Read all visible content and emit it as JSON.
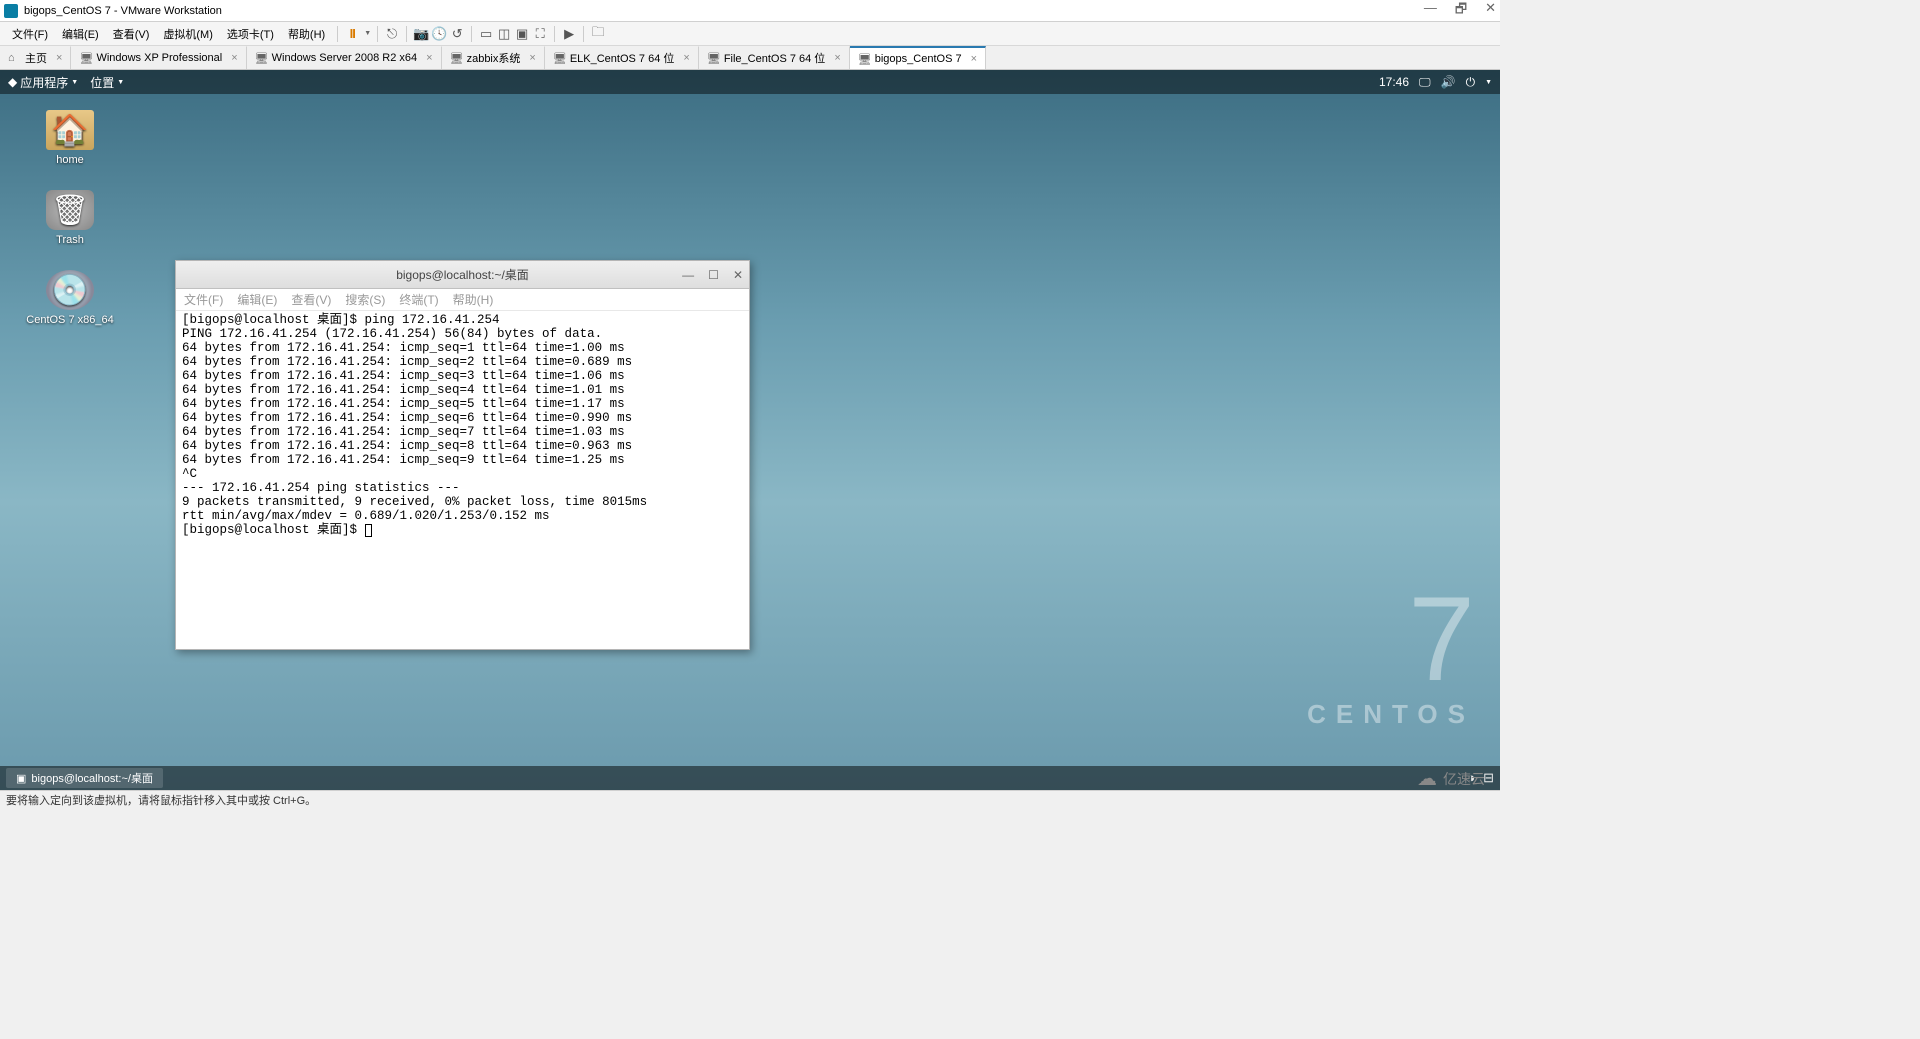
{
  "window": {
    "title": "bigops_CentOS 7 - VMware Workstation",
    "controls": {
      "min": "—",
      "restore": "🗗",
      "close": "✕"
    }
  },
  "menubar": {
    "items": [
      "文件(F)",
      "编辑(E)",
      "查看(V)",
      "虚拟机(M)",
      "选项卡(T)",
      "帮助(H)"
    ]
  },
  "tabs": [
    {
      "label": "主页",
      "icon": "⌂"
    },
    {
      "label": "Windows XP Professional",
      "icon": "🖥"
    },
    {
      "label": "Windows Server 2008 R2 x64",
      "icon": "🖥"
    },
    {
      "label": "zabbix系统",
      "icon": "🖥"
    },
    {
      "label": "ELK_CentOS 7 64 位",
      "icon": "🖥"
    },
    {
      "label": "File_CentOS 7 64 位",
      "icon": "🖥"
    },
    {
      "label": "bigops_CentOS 7",
      "icon": "🖥",
      "active": true
    }
  ],
  "gnome": {
    "apps": "应用程序",
    "places": "位置",
    "time": "17:46",
    "task": "bigops@localhost:~/桌面"
  },
  "desktop": {
    "home": "home",
    "trash": "Trash",
    "disc": "CentOS 7 x86_64"
  },
  "terminal": {
    "title": "bigops@localhost:~/桌面",
    "menu": [
      "文件(F)",
      "编辑(E)",
      "查看(V)",
      "搜索(S)",
      "终端(T)",
      "帮助(H)"
    ],
    "lines": [
      "[bigops@localhost 桌面]$ ping 172.16.41.254",
      "PING 172.16.41.254 (172.16.41.254) 56(84) bytes of data.",
      "64 bytes from 172.16.41.254: icmp_seq=1 ttl=64 time=1.00 ms",
      "64 bytes from 172.16.41.254: icmp_seq=2 ttl=64 time=0.689 ms",
      "64 bytes from 172.16.41.254: icmp_seq=3 ttl=64 time=1.06 ms",
      "64 bytes from 172.16.41.254: icmp_seq=4 ttl=64 time=1.01 ms",
      "64 bytes from 172.16.41.254: icmp_seq=5 ttl=64 time=1.17 ms",
      "64 bytes from 172.16.41.254: icmp_seq=6 ttl=64 time=0.990 ms",
      "64 bytes from 172.16.41.254: icmp_seq=7 ttl=64 time=1.03 ms",
      "64 bytes from 172.16.41.254: icmp_seq=8 ttl=64 time=0.963 ms",
      "64 bytes from 172.16.41.254: icmp_seq=9 ttl=64 time=1.25 ms",
      "^C",
      "--- 172.16.41.254 ping statistics ---",
      "9 packets transmitted, 9 received, 0% packet loss, time 8015ms",
      "rtt min/avg/max/mdev = 0.689/1.020/1.253/0.152 ms",
      "[bigops@localhost 桌面]$ "
    ]
  },
  "brand": {
    "version": "7",
    "name": "CENTOS"
  },
  "statusbar": "要将输入定向到该虚拟机，请将鼠标指针移入其中或按 Ctrl+G。",
  "watermark": "亿速云"
}
